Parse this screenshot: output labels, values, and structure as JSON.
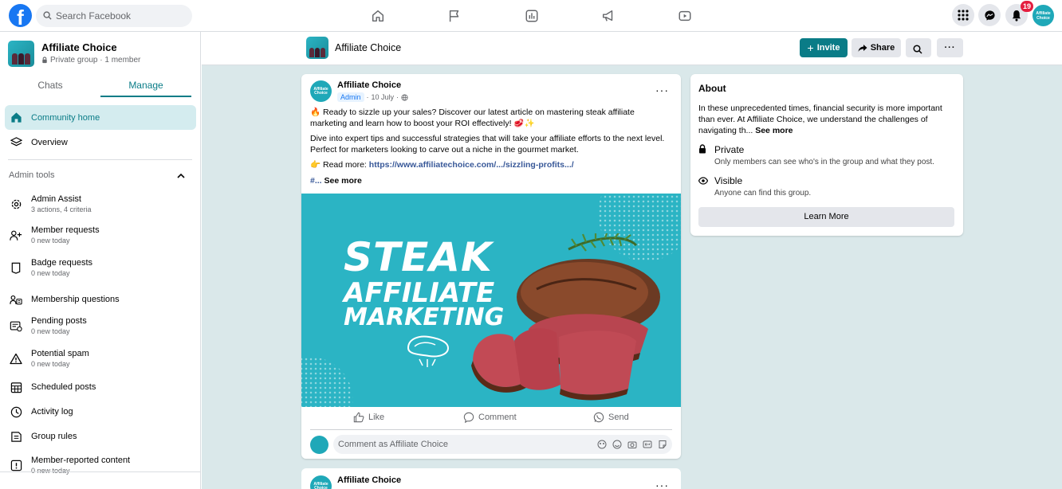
{
  "topbar": {
    "logo": "f",
    "search_placeholder": "Search Facebook",
    "nav_icons": [
      "home-icon",
      "flag-icon",
      "chart-icon",
      "megaphone-icon",
      "video-icon"
    ],
    "notification_count": "19"
  },
  "sidebar": {
    "group_name": "Affiliate Choice",
    "group_meta": "Private group · 1 member",
    "tabs": [
      "Chats",
      "Manage"
    ],
    "active_tab": "Manage",
    "items": [
      {
        "label": "Community home",
        "icon": "home-icon"
      },
      {
        "label": "Overview",
        "icon": "layers-icon"
      }
    ],
    "admin_tools_label": "Admin tools",
    "admin_items": [
      {
        "label": "Admin Assist",
        "sub": "3 actions, 4 criteria",
        "icon": "gear-icon"
      },
      {
        "label": "Member requests",
        "sub": "0 new today",
        "icon": "add-person-icon"
      },
      {
        "label": "Badge requests",
        "sub": "0 new today",
        "icon": "badge-icon"
      },
      {
        "label": "Membership questions",
        "sub": "",
        "icon": "people-question-icon"
      },
      {
        "label": "Pending posts",
        "sub": "0 new today",
        "icon": "pending-icon"
      },
      {
        "label": "Potential spam",
        "sub": "0 new today",
        "icon": "warning-icon"
      },
      {
        "label": "Scheduled posts",
        "sub": "",
        "icon": "calendar-icon"
      },
      {
        "label": "Activity log",
        "sub": "",
        "icon": "clock-icon"
      },
      {
        "label": "Group rules",
        "sub": "",
        "icon": "rules-icon"
      },
      {
        "label": "Member-reported content",
        "sub": "0 new today",
        "icon": "report-icon"
      }
    ]
  },
  "header": {
    "title": "Affiliate Choice",
    "invite_label": "Invite",
    "share_label": "Share"
  },
  "post": {
    "author": "Affiliate Choice",
    "badge": "Admin",
    "date": "10 July",
    "para1": "🔥 Ready to sizzle up your sales? Discover our latest article on mastering steak affiliate marketing and learn how to boost your ROI effectively! 🥩✨",
    "para2": "Dive into expert tips and successful strategies that will take your affiliate efforts to the next level. Perfect for marketers looking to carve out a niche in the gourmet market.",
    "read_more_prefix": "👉 Read more: ",
    "link": "https://www.affiliatechoice.com/.../sizzling-profits.../",
    "hashtag": "#...",
    "see_more": "See more",
    "image_lines": [
      "STEAK",
      "AFFILIATE",
      "MARKETING"
    ],
    "actions": [
      "Like",
      "Comment",
      "Send"
    ],
    "comment_placeholder": "Comment as Affiliate Choice"
  },
  "post2": {
    "author": "Affiliate Choice"
  },
  "avatar_text": "Affiliate Choice",
  "about": {
    "title": "About",
    "description": "In these unprecedented times, financial security is more important than ever. At Affiliate Choice, we understand the challenges of navigating th...",
    "see_more": "See more",
    "privacy_title": "Private",
    "privacy_desc": "Only members can see who's in the group and what they post.",
    "visibility_title": "Visible",
    "visibility_desc": "Anyone can find this group.",
    "learn_more": "Learn More"
  },
  "colors": {
    "accent": "#0a7c87",
    "facebook_blue": "#1877f2",
    "background": "#dae8ea",
    "badge_red": "#e41e3f"
  }
}
